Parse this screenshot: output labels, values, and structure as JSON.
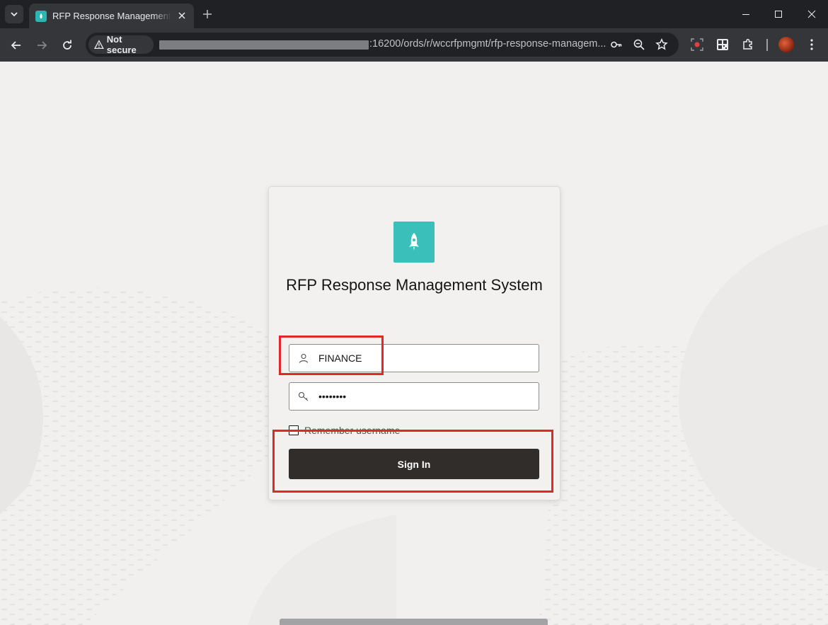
{
  "browser": {
    "tab_title": "RFP Response Management System",
    "security_label": "Not secure",
    "url_visible": ":16200/ords/r/wccrfpmgmt/rfp-response-managem..."
  },
  "login": {
    "app_title": "RFP Response Management System",
    "username_value": "FINANCE",
    "password_masked": "••••••••",
    "remember_label": "Remember username",
    "remember_checked": false,
    "signin_label": "Sign In",
    "logo_icon": "rocket-icon"
  },
  "colors": {
    "logo_bg": "#3bbfbb",
    "signin_bg": "#312d2a",
    "highlight": "#e0282a"
  }
}
